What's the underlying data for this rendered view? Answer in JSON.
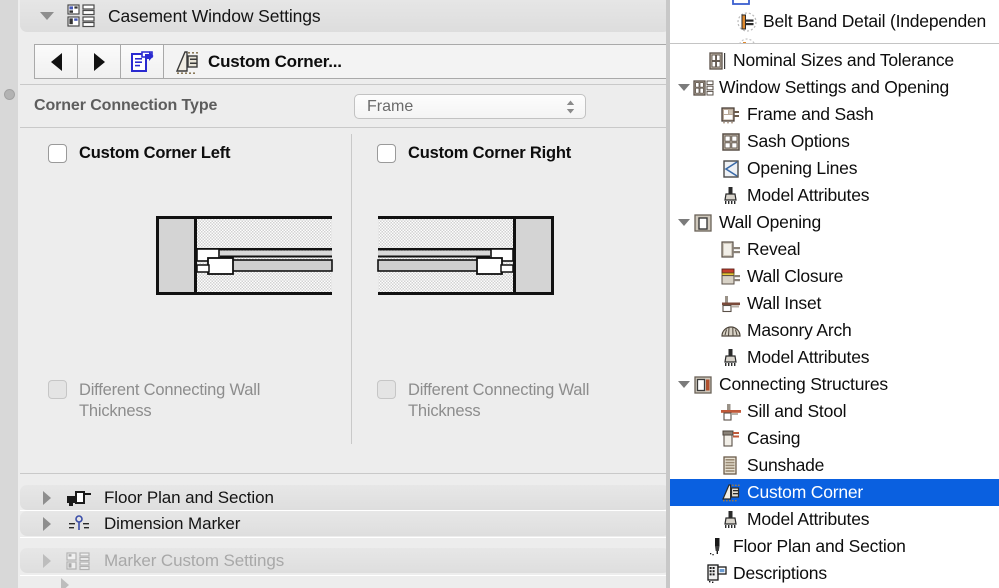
{
  "left_panel": {
    "header_section": {
      "title": "Casement Window Settings",
      "icon": "settings-grid-icon",
      "expanded": true
    },
    "toolbar": {
      "back_icon": "arrow-left-icon",
      "forward_icon": "arrow-right-icon",
      "popout_icon": "document-export-icon",
      "current_item_icon": "custom-corner-icon",
      "current_item": "Custom Corner..."
    },
    "connection_type": {
      "label": "Corner Connection Type",
      "value": "Frame",
      "chevron_icon": "chevron-updown-icon"
    },
    "panes": [
      {
        "id": "left",
        "checkbox_label": "Custom Corner Left",
        "checked": false,
        "drawing": "corner-detail-left-diagram",
        "sub_checkbox_label": "Different Connecting Wall Thickness",
        "sub_checked": false,
        "sub_disabled": true
      },
      {
        "id": "right",
        "checkbox_label": "Custom Corner Right",
        "checked": false,
        "drawing": "corner-detail-right-diagram",
        "sub_checkbox_label": "Different Connecting Wall Thickness",
        "sub_checked": false,
        "sub_disabled": true
      }
    ],
    "collapsed_sections": [
      {
        "label": "Floor Plan and Section",
        "icon": "floor-plan-section-icon",
        "disabled": false
      },
      {
        "label": "Dimension Marker",
        "icon": "dimension-marker-icon",
        "disabled": false
      },
      {
        "label": "Marker Custom Settings",
        "icon": "marker-custom-settings-icon",
        "disabled": true
      }
    ]
  },
  "top_panel": {
    "clipped_item": "Belt Band Detail (Independen",
    "clipped_item_icon": "belt-band-detail-icon"
  },
  "tree_panel": {
    "selected": "Custom Corner",
    "selection_color": "#0a60e0",
    "items": [
      {
        "label": "Nominal Sizes and Tolerance",
        "icon": "nominal-sizes-icon",
        "indent": 1,
        "twisty": "none"
      },
      {
        "label": "Window Settings and Opening",
        "icon": "window-settings-icon",
        "indent": 0,
        "twisty": "down"
      },
      {
        "label": "Frame and Sash",
        "icon": "frame-sash-icon",
        "indent": 2,
        "twisty": "none"
      },
      {
        "label": "Sash Options",
        "icon": "sash-options-icon",
        "indent": 2,
        "twisty": "none"
      },
      {
        "label": "Opening Lines",
        "icon": "opening-lines-icon",
        "indent": 2,
        "twisty": "none"
      },
      {
        "label": "Model Attributes",
        "icon": "model-attributes-icon",
        "indent": 2,
        "twisty": "none"
      },
      {
        "label": "Wall Opening",
        "icon": "wall-opening-icon",
        "indent": 0,
        "twisty": "down"
      },
      {
        "label": "Reveal",
        "icon": "reveal-icon",
        "indent": 2,
        "twisty": "none"
      },
      {
        "label": "Wall Closure",
        "icon": "wall-closure-icon",
        "indent": 2,
        "twisty": "none"
      },
      {
        "label": "Wall Inset",
        "icon": "wall-inset-icon",
        "indent": 2,
        "twisty": "none"
      },
      {
        "label": "Masonry Arch",
        "icon": "masonry-arch-icon",
        "indent": 2,
        "twisty": "none"
      },
      {
        "label": "Model Attributes",
        "icon": "model-attributes-icon",
        "indent": 2,
        "twisty": "none"
      },
      {
        "label": "Connecting Structures",
        "icon": "connecting-structures-icon",
        "indent": 0,
        "twisty": "down"
      },
      {
        "label": "Sill and Stool",
        "icon": "sill-stool-icon",
        "indent": 2,
        "twisty": "none"
      },
      {
        "label": "Casing",
        "icon": "casing-icon",
        "indent": 2,
        "twisty": "none"
      },
      {
        "label": "Sunshade",
        "icon": "sunshade-icon",
        "indent": 2,
        "twisty": "none"
      },
      {
        "label": "Custom Corner",
        "icon": "custom-corner-icon",
        "indent": 2,
        "twisty": "none",
        "selected": true
      },
      {
        "label": "Model Attributes",
        "icon": "model-attributes-icon",
        "indent": 2,
        "twisty": "none"
      },
      {
        "label": "Floor Plan and Section",
        "icon": "floor-plan-pen-icon",
        "indent": 1,
        "twisty": "none"
      },
      {
        "label": "Descriptions",
        "icon": "descriptions-icon",
        "indent": 1,
        "twisty": "none"
      }
    ]
  }
}
